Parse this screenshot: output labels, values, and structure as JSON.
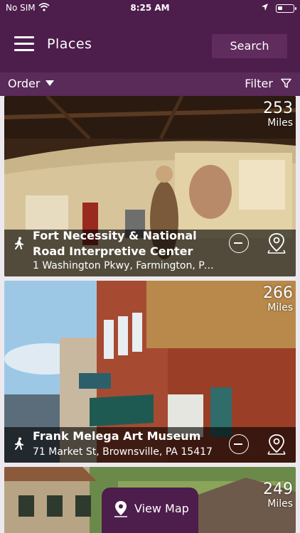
{
  "status": {
    "carrier": "No SIM",
    "time": "8:25 AM"
  },
  "nav": {
    "title": "Places",
    "search_label": "Search"
  },
  "toolbar": {
    "order_label": "Order",
    "filter_label": "Filter"
  },
  "places": [
    {
      "name": "Fort Necessity & National Road Interpretive Center",
      "address": "1 Washington Pkwy, Farmington, PA...",
      "distance": "253",
      "unit": "Miles"
    },
    {
      "name": "Frank Melega Art Museum",
      "address": "71 Market St, Brownsville, PA 15417",
      "distance": "266",
      "unit": "Miles"
    },
    {
      "name": "",
      "address": "",
      "distance": "249",
      "unit": "Miles"
    }
  ],
  "view_map_label": "View Map",
  "icons": {
    "menu": "hamburger-icon",
    "filter": "funnel-icon",
    "walk": "walking-icon",
    "remove": "remove-circle-icon",
    "location": "map-pin-icon"
  },
  "colors": {
    "brand": "#4d1d4c",
    "toolbar": "#5a2a59"
  }
}
